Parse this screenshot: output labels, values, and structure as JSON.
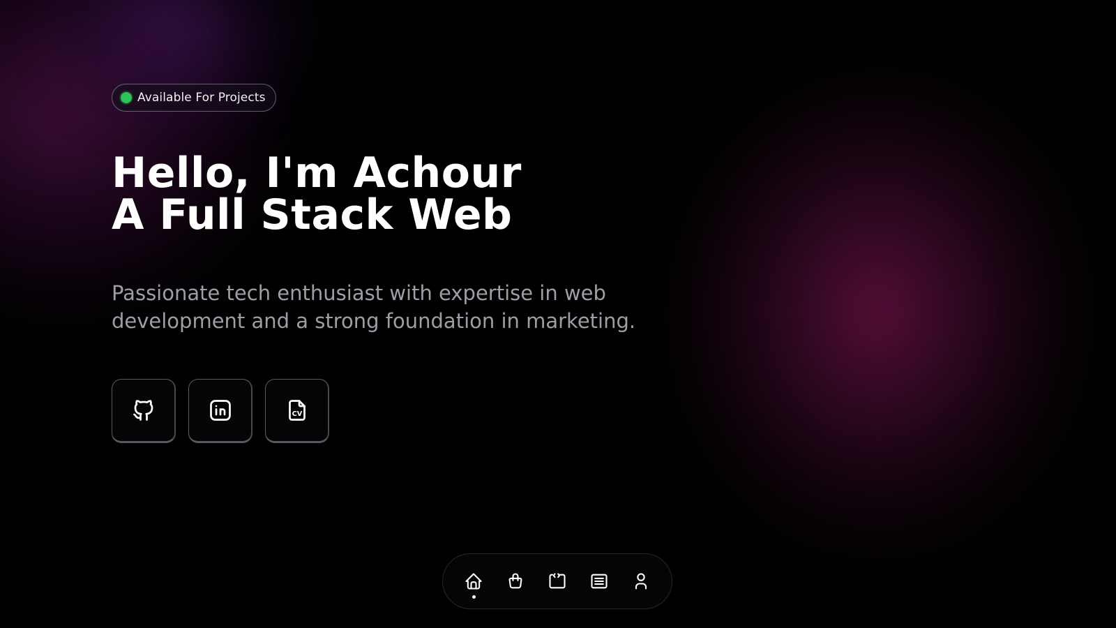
{
  "badge": {
    "text": "Available For Projects",
    "status_color": "#2ec25a"
  },
  "hero": {
    "line1": "Hello, I'm Achour",
    "line2": "A Full Stack Web",
    "subtitle": "Passionate tech enthusiast with expertise in web development and a strong foundation in marketing."
  },
  "socials": [
    {
      "name": "github",
      "icon": "github-icon"
    },
    {
      "name": "linkedin",
      "icon": "linkedin-icon"
    },
    {
      "name": "cv",
      "icon": "cv-file-icon",
      "icon_text": "CV"
    }
  ],
  "dock": {
    "items": [
      {
        "name": "home",
        "icon": "home-icon",
        "active": true
      },
      {
        "name": "shop",
        "icon": "shopping-bag-icon",
        "active": false
      },
      {
        "name": "projects",
        "icon": "code-window-icon",
        "active": false
      },
      {
        "name": "blog",
        "icon": "list-document-icon",
        "active": false
      },
      {
        "name": "about",
        "icon": "user-icon",
        "active": false
      }
    ]
  },
  "colors": {
    "background": "#000000",
    "glow_magenta": "#70124a",
    "glow_purple": "#48165f",
    "subtitle_text": "#9e9ea6"
  }
}
